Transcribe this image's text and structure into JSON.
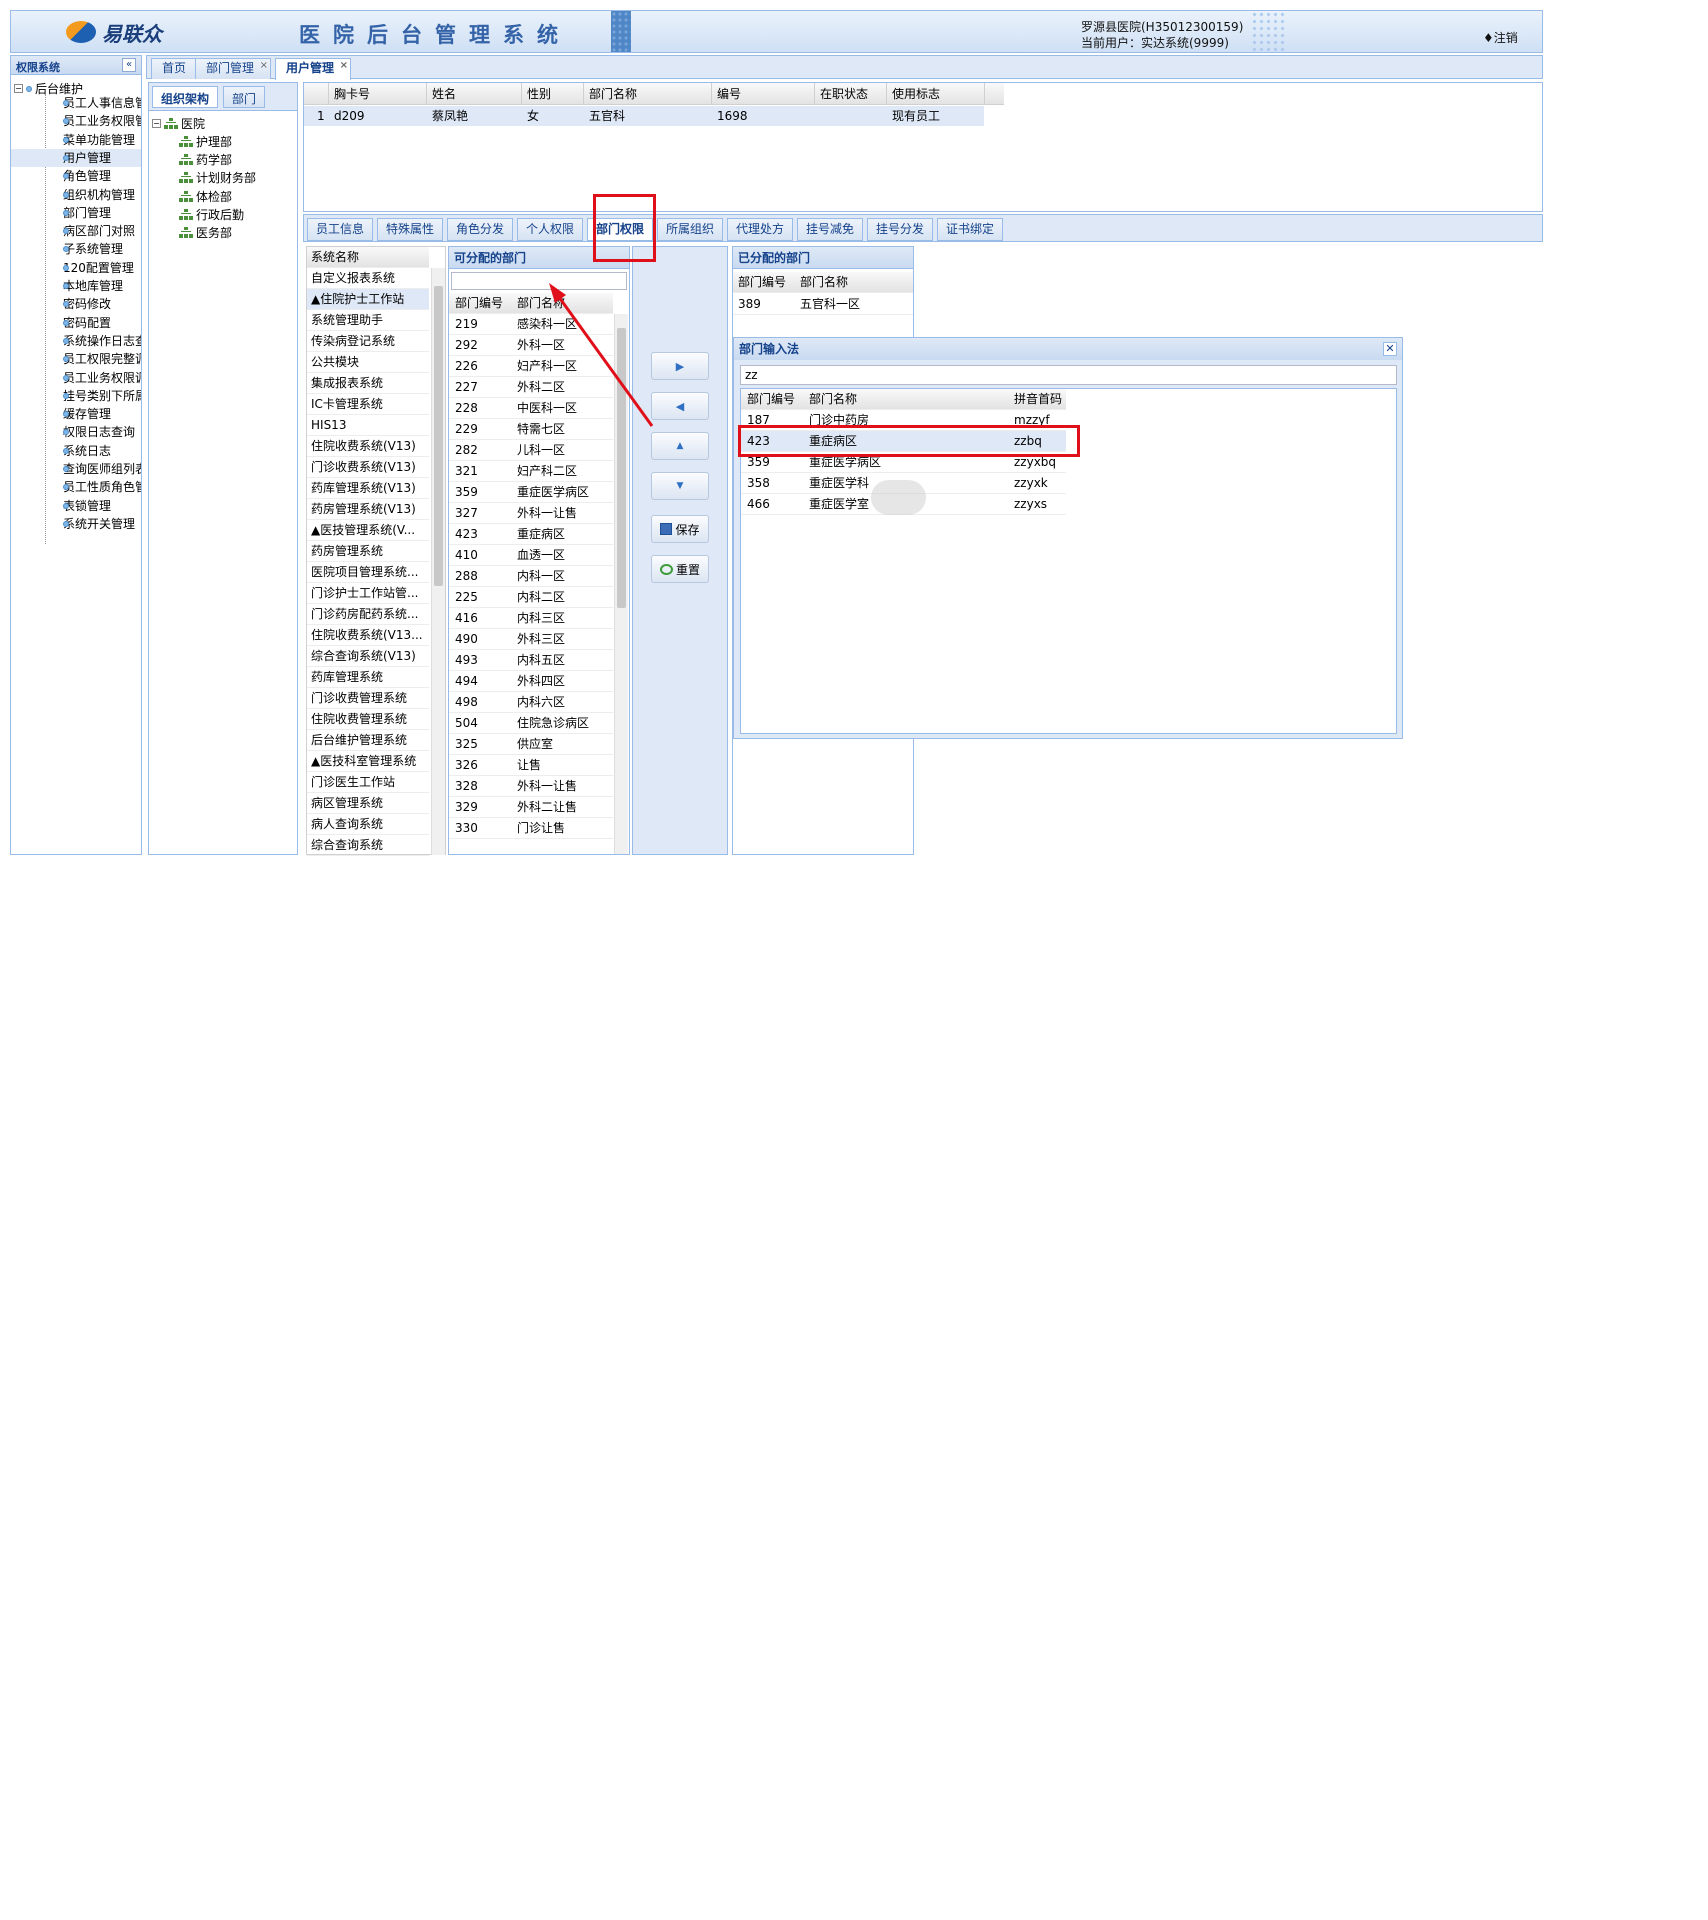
{
  "header": {
    "logo_text": "易联众",
    "system_title": "医院后台管理系统",
    "hospital": "罗源县医院(H35012300159)",
    "current_user": "当前用户：实达系统(9999)",
    "logout": "♦注销"
  },
  "left_panel": {
    "title": "权限系统",
    "collapse_icon": "«",
    "root": "后台维护",
    "items": [
      "员工人事信息管",
      "员工业务权限管",
      "菜单功能管理",
      "用户管理",
      "角色管理",
      "组织机构管理",
      "部门管理",
      "病区部门对照",
      "子系统管理",
      "120配置管理",
      "本地库管理",
      "密码修改",
      "密码配置",
      "系统操作日志查",
      "员工权限完整调",
      "员工业务权限调",
      "挂号类别下所属",
      "缓存管理",
      "权限日志查询",
      "系统日志",
      "查询医师组列表",
      "员工性质角色管",
      "表锁管理",
      "系统开关管理"
    ],
    "selected_index": 3
  },
  "tabs": [
    {
      "label": "首页",
      "closable": false
    },
    {
      "label": "部门管理",
      "closable": true
    },
    {
      "label": "用户管理",
      "closable": true,
      "active": true
    }
  ],
  "org_panel": {
    "tabs": [
      "组织架构",
      "部门"
    ],
    "root": "医院",
    "children": [
      "护理部",
      "药学部",
      "计划财务部",
      "体检部",
      "行政后勤",
      "医务部"
    ]
  },
  "employee_grid": {
    "columns": [
      "胸卡号",
      "姓名",
      "性别",
      "部门名称",
      "编号",
      "在职状态",
      "使用标志"
    ],
    "rows": [
      {
        "index": "1",
        "card": "d209",
        "name": "蔡凤艳",
        "gender": "女",
        "dept": "五官科",
        "code": "1698",
        "status": "",
        "flag": "现有员工"
      }
    ]
  },
  "sub_tabs": [
    "员工信息",
    "特殊属性",
    "角色分发",
    "个人权限",
    "部门权限",
    "所属组织",
    "代理处方",
    "挂号减免",
    "挂号分发",
    "证书绑定"
  ],
  "sub_tab_active": "部门权限",
  "system_list": {
    "header": "系统名称",
    "items": [
      "自定义报表系统",
      "▲住院护士工作站",
      "系统管理助手",
      "传染病登记系统",
      "公共模块",
      "集成报表系统",
      "IC卡管理系统",
      "HIS13",
      "住院收费系统(V13)",
      "门诊收费系统(V13)",
      "药库管理系统(V13)",
      "药房管理系统(V13)",
      "▲医技管理系统(V...",
      "药房管理系统",
      "医院项目管理系统...",
      "门诊护士工作站管...",
      "门诊药房配药系统...",
      "住院收费系统(V13...",
      "综合查询系统(V13)",
      "药库管理系统",
      "门诊收费管理系统",
      "住院收费管理系统",
      "后台维护管理系统",
      "▲医技科室管理系统",
      "门诊医生工作站",
      "病区管理系统",
      "病人查询系统",
      "综合查询系统"
    ],
    "selected_index": 1
  },
  "available_panel": {
    "title": "可分配的部门",
    "search_value": "",
    "columns": [
      "部门编号",
      "部门名称"
    ],
    "rows": [
      [
        "219",
        "感染科一区"
      ],
      [
        "292",
        "外科一区"
      ],
      [
        "226",
        "妇产科一区"
      ],
      [
        "227",
        "外科二区"
      ],
      [
        "228",
        "中医科一区"
      ],
      [
        "229",
        "特需七区"
      ],
      [
        "282",
        "儿科一区"
      ],
      [
        "321",
        "妇产科二区"
      ],
      [
        "359",
        "重症医学病区"
      ],
      [
        "327",
        "外科一让售"
      ],
      [
        "423",
        "重症病区"
      ],
      [
        "410",
        "血透一区"
      ],
      [
        "288",
        "内科一区"
      ],
      [
        "225",
        "内科二区"
      ],
      [
        "416",
        "内科三区"
      ],
      [
        "490",
        "外科三区"
      ],
      [
        "493",
        "内科五区"
      ],
      [
        "494",
        "外科四区"
      ],
      [
        "498",
        "内科六区"
      ],
      [
        "504",
        "住院急诊病区"
      ],
      [
        "325",
        "供应室"
      ],
      [
        "326",
        "让售"
      ],
      [
        "328",
        "外科一让售"
      ],
      [
        "329",
        "外科二让售"
      ],
      [
        "330",
        "门诊让售"
      ]
    ]
  },
  "buttons": {
    "add_icon": "▶",
    "remove_icon": "◀",
    "up_icon": "▲",
    "down_icon": "▼",
    "save_label": "保存",
    "reset_label": "重置"
  },
  "assigned_panel": {
    "title": "已分配的部门",
    "columns": [
      "部门编号",
      "部门名称"
    ],
    "rows": [
      [
        "389",
        "五官科一区"
      ]
    ]
  },
  "popup": {
    "title": "部门输入法",
    "close_icon": "✕",
    "input_value": "zz",
    "columns": [
      "部门编号",
      "部门名称",
      "拼音首码"
    ],
    "rows": [
      [
        "187",
        "门诊中药房",
        "mzzyf"
      ],
      [
        "423",
        "重症病区",
        "zzbq"
      ],
      [
        "359",
        "重症医学病区",
        "zzyxbq"
      ],
      [
        "358",
        "重症医学科",
        "zzyxk"
      ],
      [
        "466",
        "重症医学室",
        "zzyxs"
      ]
    ],
    "selected_index": 1
  },
  "colors": {
    "border": "#99bbe8",
    "header_text": "#15428b",
    "panel_bg": "#dfe8f6",
    "annotation": "#e0101a"
  }
}
